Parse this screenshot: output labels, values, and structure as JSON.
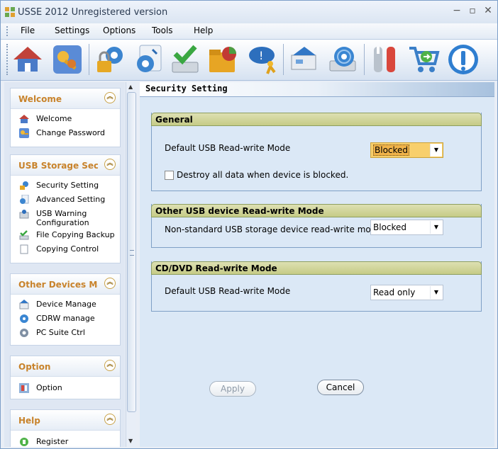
{
  "window": {
    "title": "USSE 2012 Unregistered version",
    "controls": [
      "−",
      "▫",
      "✕"
    ]
  },
  "menu": {
    "file": "File",
    "settings": "Settings",
    "options": "Options",
    "tools": "Tools",
    "help": "Help"
  },
  "toolbar": [
    "home-icon",
    "key-icon",
    "lock-gear-icon",
    "usb-gear-icon",
    "drive-check-icon",
    "folder-pie-icon",
    "chat-run-icon",
    "device-network-icon",
    "disc-drive-icon",
    "tools-icon",
    "cart-icon",
    "info-icon"
  ],
  "sidebar": {
    "welcome": {
      "title": "Welcome",
      "items": [
        "Welcome",
        "Change Password"
      ]
    },
    "usb": {
      "title": "USB Storage Secu...",
      "items": [
        "Security Setting",
        "Advanced Setting",
        "USB Warning",
        "Configuration",
        "File Copying Backup",
        "Copying Control"
      ]
    },
    "other": {
      "title": "Other Devices Ma...",
      "items": [
        "Device Manage",
        "CDRW manage",
        "PC Suite Ctrl"
      ]
    },
    "option": {
      "title": "Option",
      "items": [
        "Option"
      ]
    },
    "help": {
      "title": "Help",
      "items": [
        "Register"
      ]
    }
  },
  "content": {
    "title": "Security Setting",
    "general": {
      "title": "General",
      "usb_mode_label": "Default USB Read-write Mode",
      "usb_mode_value": "Blocked",
      "destroy_label": "Destroy all data when device is blocked."
    },
    "other_usb": {
      "title": "Other USB device Read-write Mode",
      "label": "Non-standard USB storage device read-write mode",
      "value": "Blocked"
    },
    "cddvd": {
      "title": "CD/DVD Read-write Mode",
      "label": "Default USB Read-write Mode",
      "value": "Read only"
    },
    "apply": "Apply",
    "cancel": "Cancel"
  }
}
